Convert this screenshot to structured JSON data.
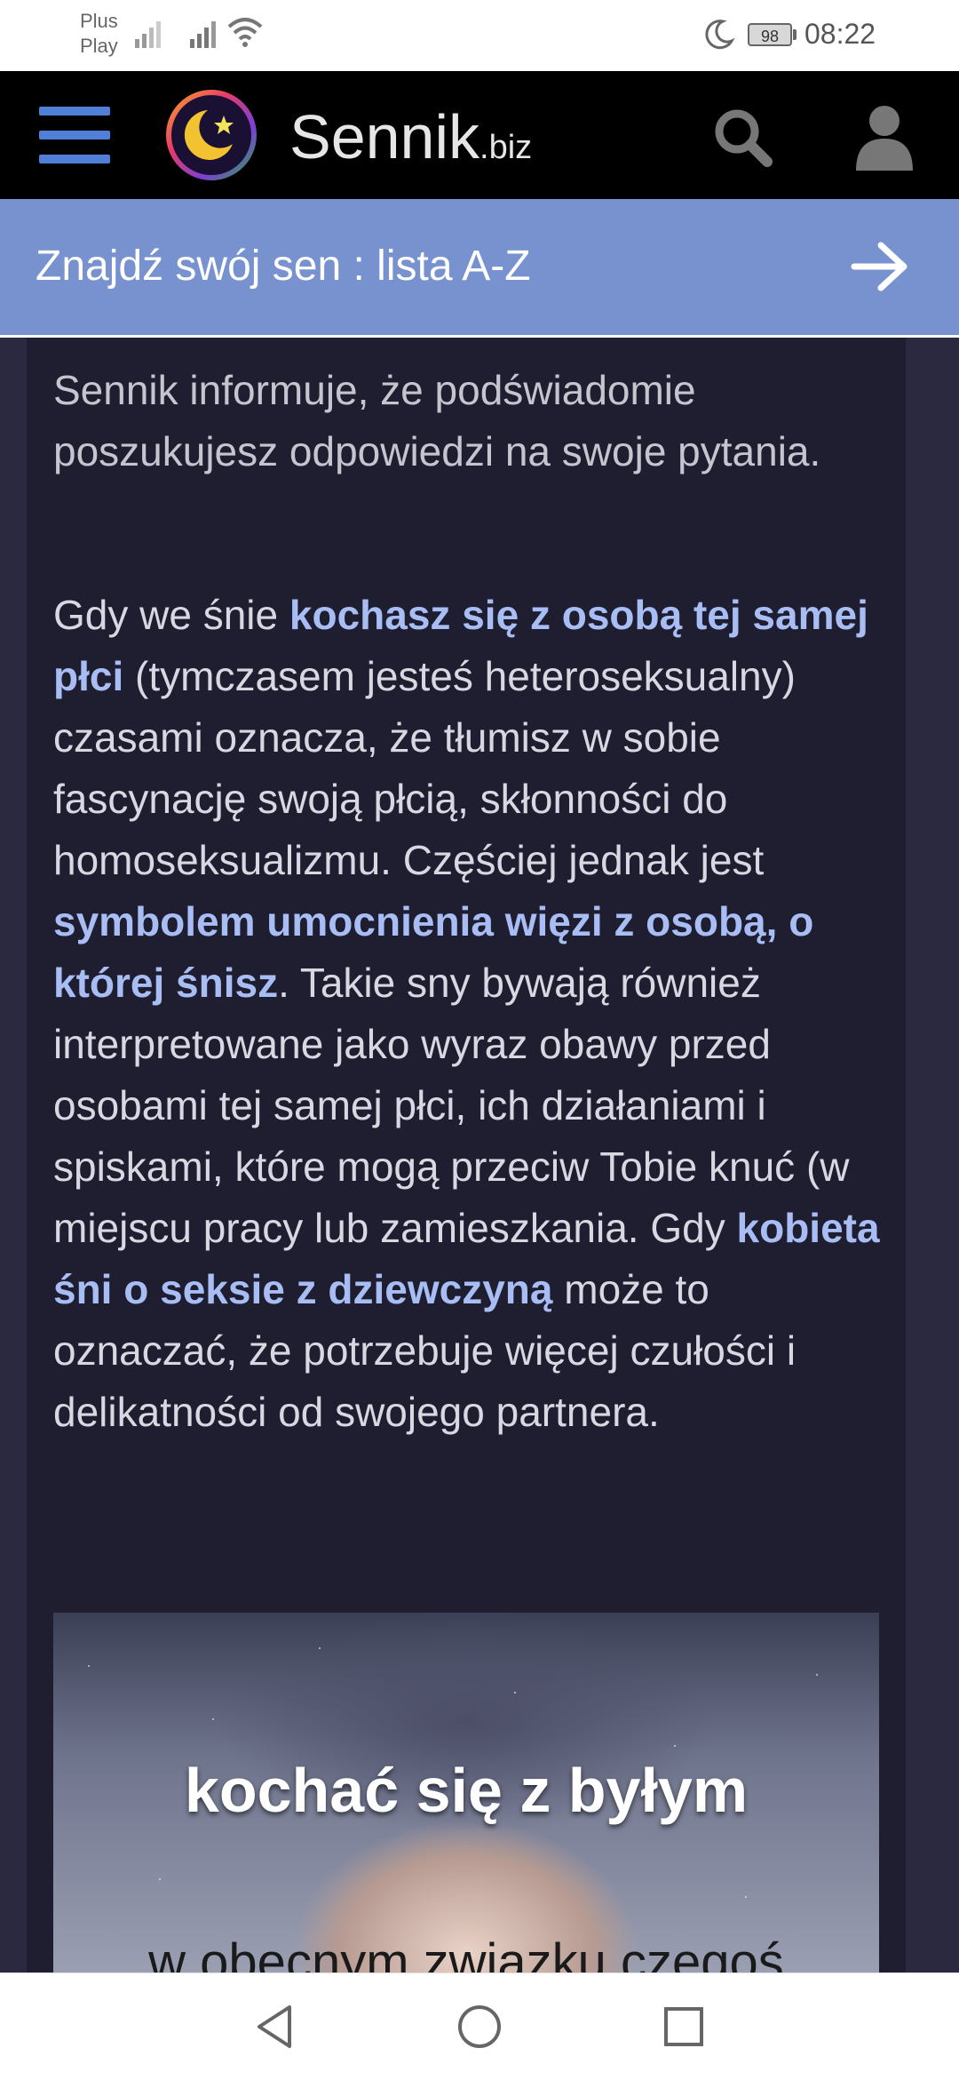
{
  "status_bar": {
    "carrier_line1": "Plus",
    "carrier_line2": "Play",
    "battery": "98",
    "time": "08:22"
  },
  "header": {
    "brand_name": "Sennik",
    "brand_tld": ".biz"
  },
  "banner": {
    "text": "Znajdź swój sen : lista A-Z"
  },
  "article": {
    "p0_text": "Sennik informuje, że podświadomie poszukujesz odpowiedzi na swoje pytania.",
    "p1_a": "Gdy we śnie ",
    "p1_hl1": "kochasz się z osobą tej samej płci",
    "p1_b": " (tymczasem jesteś heteroseksualny) czasami oznacza, że tłumisz w sobie fascynację swoją płcią, skłonności do homoseksualizmu. Częściej jednak jest ",
    "p1_hl2": "symbolem umocnienia więzi z osobą, o której śnisz",
    "p1_c": ". Takie sny bywają również interpretowane jako wyraz obawy przed osobami tej samej płci, ich działaniami i spiskami, które mogą przeciw Tobie knuć (w miejscu pracy lub zamieszkania. Gdy ",
    "p1_hl3": "kobieta śni o seksie z dziewczyną",
    "p1_d": " może to oznaczać, że potrzebuje więcej czułości i delikatności od swojego partnera."
  },
  "image": {
    "title": "kochać się z byłym",
    "subtitle": "w obecnym związku czegoś"
  },
  "colors": {
    "background": "#2a2940",
    "card": "#1f1e30",
    "highlight": "#a7bdf3",
    "banner": "#7792cf",
    "menu": "#4f7fd6"
  }
}
